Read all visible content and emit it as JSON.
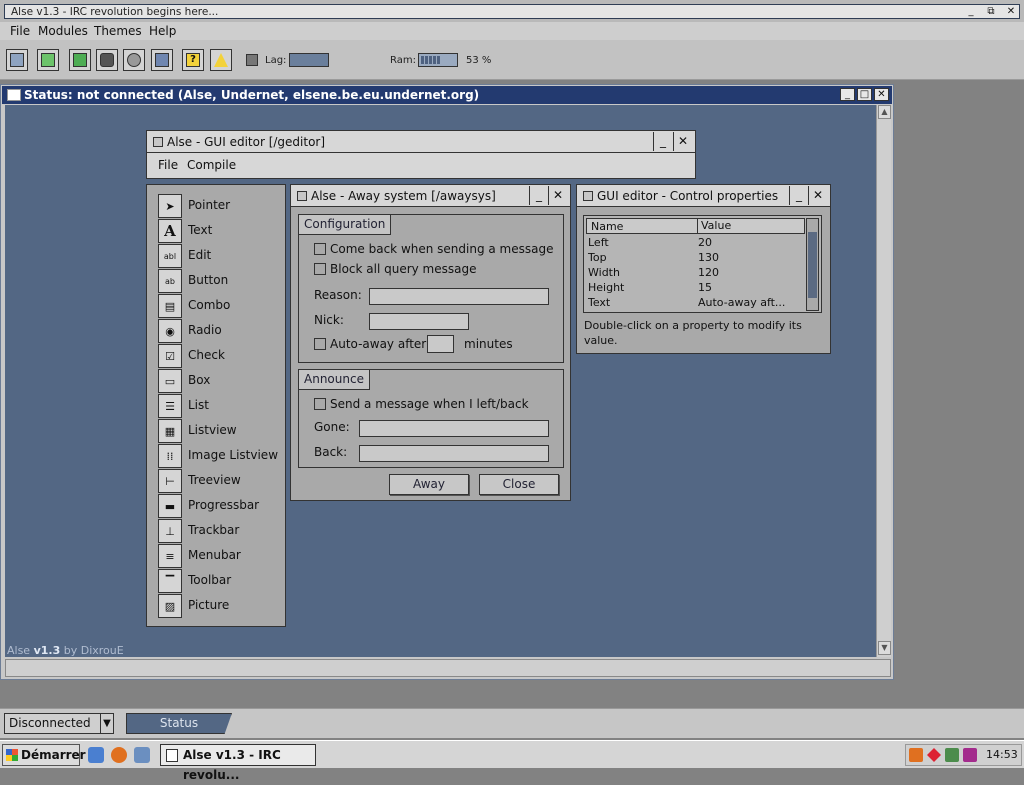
{
  "app": {
    "title": "Alse v1.3 - IRC revolution begins here...",
    "controls": {
      "minimize": "_",
      "restore": "⧉",
      "close": "✕"
    }
  },
  "menu": [
    "File",
    "Modules",
    "Themes",
    "Help"
  ],
  "toolbar": {
    "icons": [
      "server-icon",
      "options-icon",
      "addressbook-icon",
      "channel-list-icon",
      "notify-icon",
      "dcc-icon",
      "help-icon",
      "warning-icon",
      "lag-icon"
    ],
    "lag_label": "Lag:",
    "ram_label": "Ram:",
    "ram_percent": "53 %",
    "ram_fill": 0.53
  },
  "status_window": {
    "title": "Status: not connected (Alse, Undernet, elsene.be.eu.undernet.org)",
    "footer_prefix": "Alse ",
    "footer_version": "v1.3",
    "footer_suffix": " by DixrouE"
  },
  "gui_editor": {
    "title": "Alse - GUI editor [/geditor]",
    "menu": [
      "File",
      "Compile"
    ]
  },
  "palette": [
    {
      "label": "Pointer",
      "icon": "pointer-icon",
      "glyph": "➤"
    },
    {
      "label": "Text",
      "icon": "text-icon",
      "glyph": "A"
    },
    {
      "label": "Edit",
      "icon": "edit-icon",
      "glyph": "abl"
    },
    {
      "label": "Button",
      "icon": "button-icon",
      "glyph": "ab"
    },
    {
      "label": "Combo",
      "icon": "combo-icon",
      "glyph": "▤"
    },
    {
      "label": "Radio",
      "icon": "radio-icon",
      "glyph": "◉"
    },
    {
      "label": "Check",
      "icon": "check-icon",
      "glyph": "☑"
    },
    {
      "label": "Box",
      "icon": "box-icon",
      "glyph": "▭"
    },
    {
      "label": "List",
      "icon": "list-icon",
      "glyph": "☰"
    },
    {
      "label": "Listview",
      "icon": "listview-icon",
      "glyph": "▦"
    },
    {
      "label": "Image Listview",
      "icon": "image-listview-icon",
      "glyph": "⁞⁞"
    },
    {
      "label": "Treeview",
      "icon": "treeview-icon",
      "glyph": "⊢"
    },
    {
      "label": "Progressbar",
      "icon": "progressbar-icon",
      "glyph": "▬"
    },
    {
      "label": "Trackbar",
      "icon": "trackbar-icon",
      "glyph": "⊥"
    },
    {
      "label": "Menubar",
      "icon": "menubar-icon",
      "glyph": "≡"
    },
    {
      "label": "Toolbar",
      "icon": "toolbar-icon",
      "glyph": "▔"
    },
    {
      "label": "Picture",
      "icon": "picture-icon",
      "glyph": "▨"
    }
  ],
  "away": {
    "title": "Alse - Away system [/awaysys]",
    "config_label": "Configuration",
    "come_back": "Come back when sending a message",
    "block_query": "Block all query message",
    "reason_label": "Reason:",
    "reason_value": "",
    "nick_label": "Nick:",
    "nick_value": "",
    "auto_away": "Auto-away after",
    "auto_away_value": "",
    "minutes": "minutes",
    "announce_label": "Announce",
    "send_msg": "Send a message when I left/back",
    "gone_label": "Gone:",
    "gone_value": "",
    "back_label": "Back:",
    "back_value": "",
    "away_btn": "Away",
    "close_btn": "Close"
  },
  "props": {
    "title": "GUI editor - Control properties",
    "col_name": "Name",
    "col_value": "Value",
    "rows": [
      {
        "name": "Left",
        "value": "20"
      },
      {
        "name": "Top",
        "value": "130"
      },
      {
        "name": "Width",
        "value": "120"
      },
      {
        "name": "Height",
        "value": "15"
      },
      {
        "name": "Text",
        "value": "Auto-away aft..."
      }
    ],
    "hint": "Double-click on a property to modify its value."
  },
  "bottom": {
    "connection": "Disconnected",
    "status_tab": "Status"
  },
  "taskbar": {
    "start": "Démarrer",
    "task": "Alse v1.3 - IRC revolu...",
    "clock": "14:53"
  }
}
